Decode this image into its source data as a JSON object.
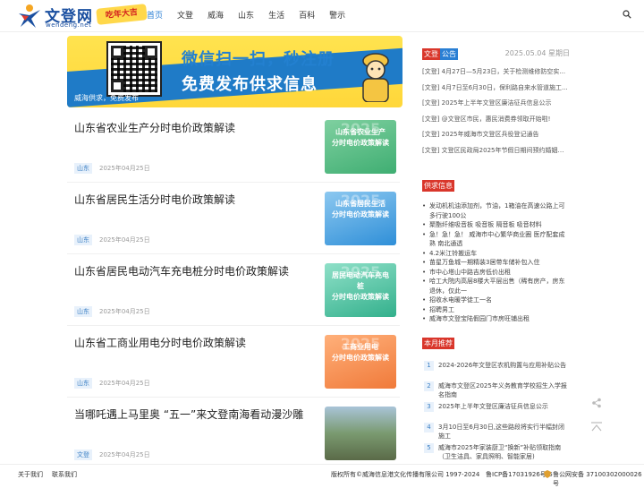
{
  "header": {
    "logo_text": "文登网",
    "logo_sub": "wendeng.net",
    "logo_badge": "吃年大吉",
    "nav": [
      "首页",
      "文登",
      "威海",
      "山东",
      "生活",
      "百科",
      "警示"
    ]
  },
  "banner": {
    "title": "微信扫一扫，秒注册",
    "subtitle": "免费发布供求信息",
    "caption": "威海供求，免费发布"
  },
  "articles": [
    {
      "title": "山东省农业生产分时电价政策解读",
      "tag": "山东",
      "date": "2025年04月25日",
      "thumb_text": "山东省农业生产\n分时电价政策解读",
      "thumb_color": "#3fae72"
    },
    {
      "title": "山东省居民生活分时电价政策解读",
      "tag": "山东",
      "date": "2025年04月25日",
      "thumb_text": "山东省居民生活\n分时电价政策解读",
      "thumb_color": "#2f8fd8"
    },
    {
      "title": "山东省居民电动汽车充电桩分时电价政策解读",
      "tag": "山东",
      "date": "2025年04月25日",
      "thumb_text": "居民电动汽车充电桩\n分时电价政策解读",
      "thumb_color": "#33b08c"
    },
    {
      "title": "山东省工商业用电分时电价政策解读",
      "tag": "山东",
      "date": "2025年04月25日",
      "thumb_text": "工商业用电\n分时电价政策解读",
      "thumb_color": "#f07a3a"
    },
    {
      "title": "当哪吒遇上马里奥 “五一”来文登南海看动漫沙雕",
      "tag": "文登",
      "date": "2025年04月25日",
      "thumb_text": "",
      "thumb_color": "#6a8a5a"
    }
  ],
  "notice": {
    "chip1": "文登",
    "chip2": "公告",
    "date": "2025.05.04 星期日",
    "items": [
      "[文登] 4月27日—5月23日，关于检测维修防空实...",
      "[文登] 4月7日至6月30日，保利路自来水管道施工...",
      "[文登] 2025年上半年文登区廉洁征兵信息公示",
      "[文登] @文登区市民，惠民消费券领取开始啦!",
      "[文登] 2025年威海市文登区兵役登记通告",
      "[文登] 文登区民政局2025年节假日期间预约婚姻登..."
    ]
  },
  "supply": {
    "heading": "供求信息",
    "items": [
      "发动机机油添加剂，节油，1箱油在高速公路上可多行驶100公",
      "聚酯纤维吸音板 吸音板 隔音板 吸音材料",
      "急！急！急！ 威海市中心繁华商业圈 医疗配套成熟 南北通透",
      "4.2米江铃搬运车",
      "苗星万鱼城一期精装3居带车储补包入住",
      "市中心塔山中路吉房低价出租",
      "哈工大院内高层8楼大平层出售（稀有房产，房东退休，仅此一",
      "招收水电暖学徒工一名",
      "招聘男工",
      "威海市文登宝陆假园门市房旺铺出租"
    ]
  },
  "ranking": {
    "heading": "本月推荐",
    "items": [
      "2024-2026年文登区农机购置与应用补贴公告",
      "威海市文登区2025年义务教育学校招生入学报名指南",
      "2025年上半年文登区廉洁征兵信息公示",
      "3月10日至6月30日,这些路段将实行半幅封闭施工",
      "威海市2025年家装厨卫“换新”补贴领取指南（卫生洁具、家具照明、智能家居)"
    ]
  },
  "footer": {
    "about": "关于我们",
    "contact": "联系我们",
    "copyright": "版权所有©威海信息港文化传播有限公司 1997-2024",
    "icp": "鲁ICP备17031926号-5",
    "police": "鲁公网安备 37100302000026号"
  },
  "colors": {
    "accent": "#2a7fd4",
    "red": "#d9362b",
    "banner_yellow": "#ffd73a"
  }
}
